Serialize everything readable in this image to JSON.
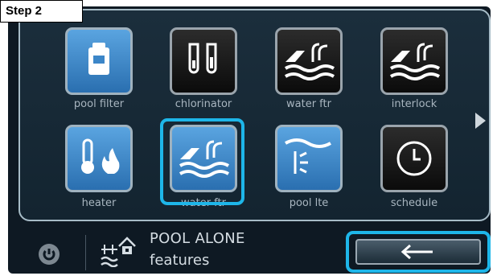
{
  "step_label": "Step 2",
  "tiles": [
    {
      "label": "pool filter",
      "icon": "pool-filter-icon"
    },
    {
      "label": "chlorinator",
      "icon": "chlorinator-icon"
    },
    {
      "label": "water ftr",
      "icon": "water-feature-icon"
    },
    {
      "label": "interlock",
      "icon": "interlock-icon"
    },
    {
      "label": "heater",
      "icon": "heater-icon"
    },
    {
      "label": "water ftr",
      "icon": "water-feature-icon"
    },
    {
      "label": "pool lte",
      "icon": "pool-light-icon"
    },
    {
      "label": "schedule",
      "icon": "clock-icon"
    }
  ],
  "footer": {
    "title": "POOL ALONE",
    "subtitle": "features"
  },
  "colors": {
    "highlight": "#1eb6e9",
    "tile_blue": "#3c86c8",
    "screen_bg": "#0e1923"
  }
}
